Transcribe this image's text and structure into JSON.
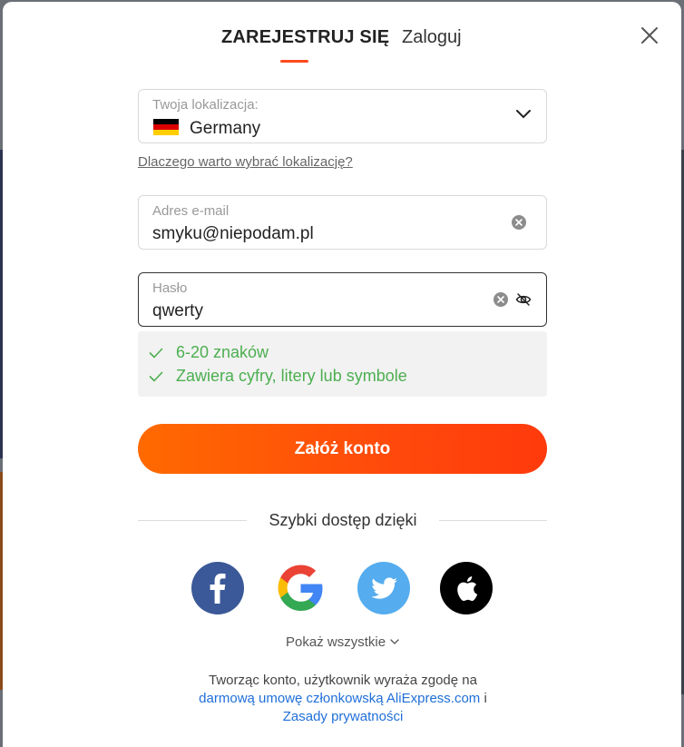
{
  "tabs": {
    "register": "ZAREJESTRUJ SIĘ",
    "login": "Zaloguj"
  },
  "location": {
    "label": "Twoja lokalizacja:",
    "value": "Germany",
    "flag_colors": [
      "#000000",
      "#DD0000",
      "#FFCE00"
    ]
  },
  "why_link": "Dlaczego warto wybrać lokalizację?",
  "email": {
    "label": "Adres e-mail",
    "value": "smyku@niepodam.pl"
  },
  "password": {
    "label": "Hasło",
    "value": "qwerty"
  },
  "password_rules": [
    "6-20 znaków",
    "Zawiera cyfry, litery lub symbole"
  ],
  "submit_label": "Załóż konto",
  "quick_access": "Szybki dostęp dzięki",
  "social": [
    {
      "icon": "facebook-icon",
      "color": "#3b5998"
    },
    {
      "icon": "google-icon",
      "color": "#ffffff"
    },
    {
      "icon": "twitter-icon",
      "color": "#55acee"
    },
    {
      "icon": "apple-icon",
      "color": "#000000"
    }
  ],
  "show_all": "Pokaż wszystkie",
  "terms": {
    "prefix": "Tworząc konto, użytkownik wyraża zgodę na",
    "link1": "darmową umowę członkowską AliExpress.com",
    "conj": "i",
    "link2": "Zasady prywatności"
  },
  "colors": {
    "accent": "#ff4b1f",
    "success": "#4caf50",
    "link": "#1f6fd8"
  }
}
